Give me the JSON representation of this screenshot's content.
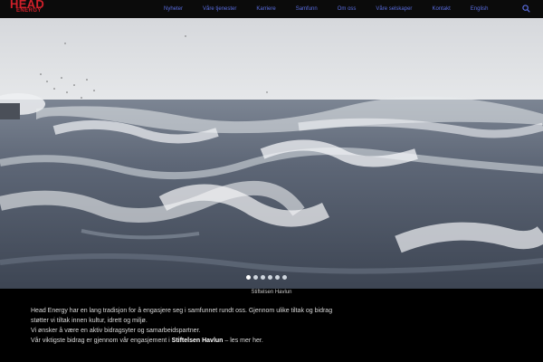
{
  "logo": {
    "line1": "HEAD",
    "line2": "ENERGY"
  },
  "nav": {
    "items": [
      "Nyheter",
      "Våre tjenester",
      "Karriere",
      "Samfunn",
      "Om oss",
      "Våre selskaper",
      "Kontakt",
      "English"
    ],
    "search_icon": "search-icon"
  },
  "hero": {
    "image": "stormy-sea-waves",
    "slides": 6,
    "active_slide": 1,
    "caption": "Stiftelsen Havlun"
  },
  "body": {
    "line1": "Head Energy har en lang tradisjon for å engasjere seg i samfunnet rundt oss. Gjennom ulike tiltak og bidrag",
    "line2": "støtter vi tiltak innen kultur, idrett og miljø.",
    "line3": "Vi ønsker å være en aktiv bidragsyter og samarbeidspartner.",
    "line4_pre": "Vår viktigste bidrag er gjennom vår engasjement i",
    "line4_link": "Stiftelsen Havlun",
    "line4_post": "– les mer her."
  },
  "colors": {
    "brand_red": "#d0202a",
    "nav_blue": "#5a6de0",
    "background": "#000000"
  }
}
